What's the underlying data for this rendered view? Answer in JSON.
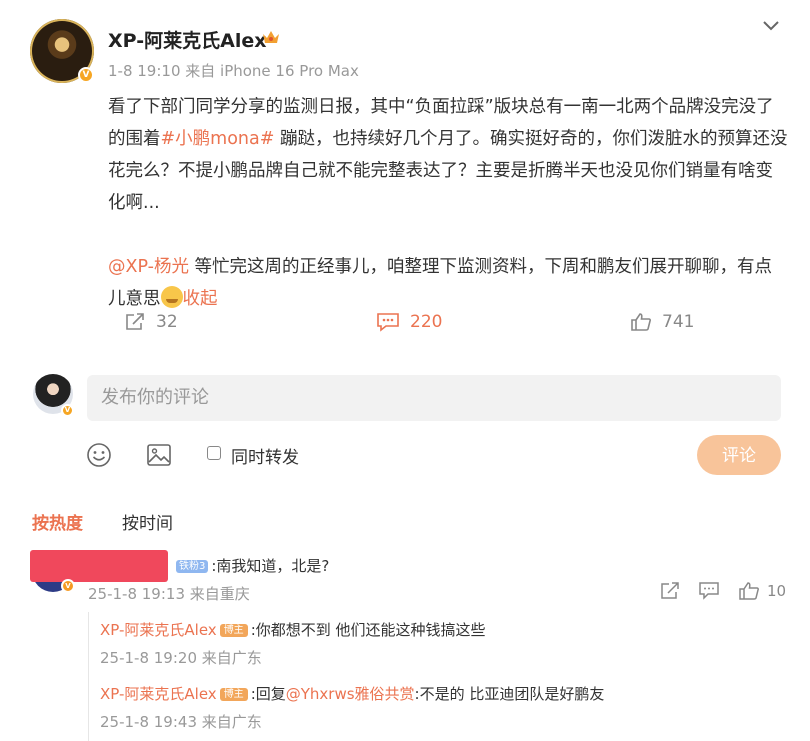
{
  "post": {
    "author": "XP-阿莱克氏Alex",
    "meta": "1-8 19:10  来自 iPhone 16 Pro Max",
    "body_line1_a": "看了下部门同学分享的监测日报，其中“负面拉踩”版块总有一南一北两个品牌没完没了的围着",
    "hashtag": "#小鹏mona#",
    "body_line1_b": " 蹦跶，也持续好几个月了。确实挺好奇的，你们泼脏水的预算还没花完么？不提小鹏品牌自己就不能完整表达了？主要是折腾半天也没见你们销量有啥变化啊...",
    "mention": "@XP-杨光",
    "body_line2": " 等忙完这周的正经事儿，咱整理下监测资料，下周和鹏友们展开聊聊，有点儿意思",
    "collapse": "收起",
    "reposts": "32",
    "comments": "220",
    "likes": "741"
  },
  "composer": {
    "placeholder": "发布你的评论",
    "repost_label": "同时转发",
    "submit_label": "评论"
  },
  "tabs": {
    "hot": "按热度",
    "time": "按时间"
  },
  "comments": [
    {
      "badge": "铁粉3",
      "text": ":南我知道，北是?",
      "meta": "25-1-8 19:13 来自重庆",
      "likes": "10"
    }
  ],
  "replies": [
    {
      "name": "XP-阿莱克氏Alex",
      "badge": "博主",
      "text": ":你都想不到 他们还能这种钱搞这些",
      "meta": "25-1-8 19:20 来自广东"
    },
    {
      "name": "XP-阿莱克氏Alex",
      "badge": "博主",
      "prefix": ":回复",
      "mention": "@Yhxrws雅俗共赏",
      "text": ":不是的 比亚迪团队是好鹏友",
      "meta": "25-1-8 19:43 来自广东"
    }
  ],
  "colors": {
    "accent": "#eb7350",
    "submit_bg": "#f8c49a",
    "muted": "#999999"
  }
}
